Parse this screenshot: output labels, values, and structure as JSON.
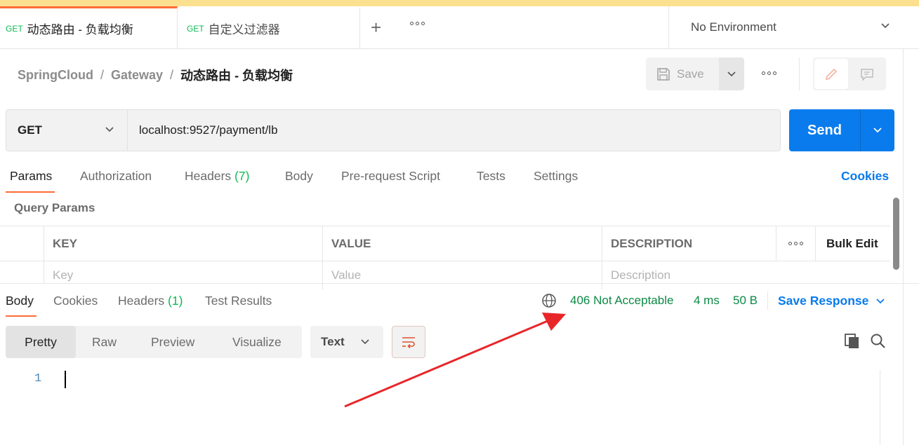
{
  "tabs": [
    {
      "method": "GET",
      "name": "动态路由 - 负载均衡"
    },
    {
      "method": "GET",
      "name": "自定义过滤器"
    }
  ],
  "environment": "No Environment",
  "breadcrumb": {
    "collection": "SpringCloud",
    "folder": "Gateway",
    "request": "动态路由 - 负载均衡",
    "separator": "/"
  },
  "toolbar": {
    "save_label": "Save"
  },
  "request": {
    "method": "GET",
    "url": "localhost:9527/payment/lb",
    "send_label": "Send"
  },
  "request_tabs": {
    "params": "Params",
    "authorization": "Authorization",
    "headers": "Headers",
    "headers_count": "(7)",
    "body": "Body",
    "prerequest": "Pre-request Script",
    "tests": "Tests",
    "settings": "Settings",
    "cookies": "Cookies"
  },
  "query_params": {
    "title": "Query Params",
    "columns": {
      "key": "KEY",
      "value": "VALUE",
      "description": "DESCRIPTION",
      "bulk_edit": "Bulk Edit"
    },
    "placeholders": {
      "key": "Key",
      "value": "Value",
      "description": "Description"
    }
  },
  "response_tabs": {
    "body": "Body",
    "cookies": "Cookies",
    "headers": "Headers",
    "headers_count": "(1)",
    "test_results": "Test Results"
  },
  "response_status": {
    "status": "406 Not Acceptable",
    "time": "4 ms",
    "size": "50 B",
    "save_response": "Save Response"
  },
  "body_view": {
    "pretty": "Pretty",
    "raw": "Raw",
    "preview": "Preview",
    "visualize": "Visualize",
    "format": "Text"
  },
  "editor": {
    "line_number": "1"
  },
  "colors": {
    "accent": "#ff6c37",
    "primary": "#097bed",
    "success": "#0c8a45",
    "method_get": "#0cbb52",
    "annotation_arrow": "#e8262a"
  }
}
